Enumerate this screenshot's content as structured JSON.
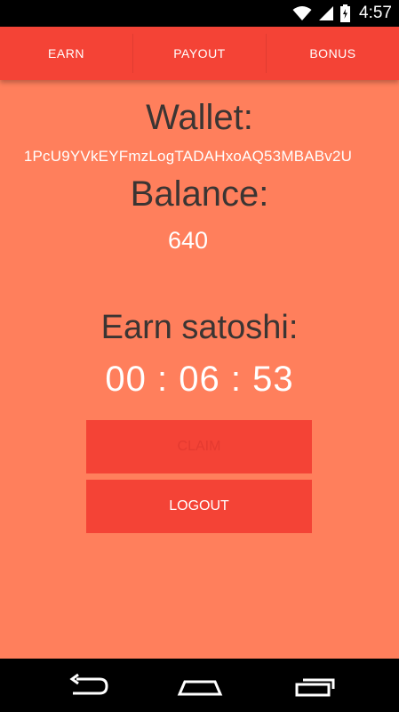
{
  "status_bar": {
    "time": "4:57"
  },
  "tabs": [
    {
      "label": "EARN"
    },
    {
      "label": "PAYOUT"
    },
    {
      "label": "BONUS"
    }
  ],
  "wallet": {
    "heading": "Wallet:",
    "address": "1PcU9YVkEYFmzLogTADAHxoAQ53MBABv2U"
  },
  "balance": {
    "heading": "Balance:",
    "value": "640"
  },
  "earn": {
    "heading": "Earn satoshi:",
    "timer": "00 : 06 : 53"
  },
  "buttons": {
    "claim_label": "CLAIM",
    "logout_label": "LOGOUT"
  },
  "colors": {
    "background": "#ff7f5c",
    "accent": "#f44336",
    "heading_text": "#3b3533"
  }
}
